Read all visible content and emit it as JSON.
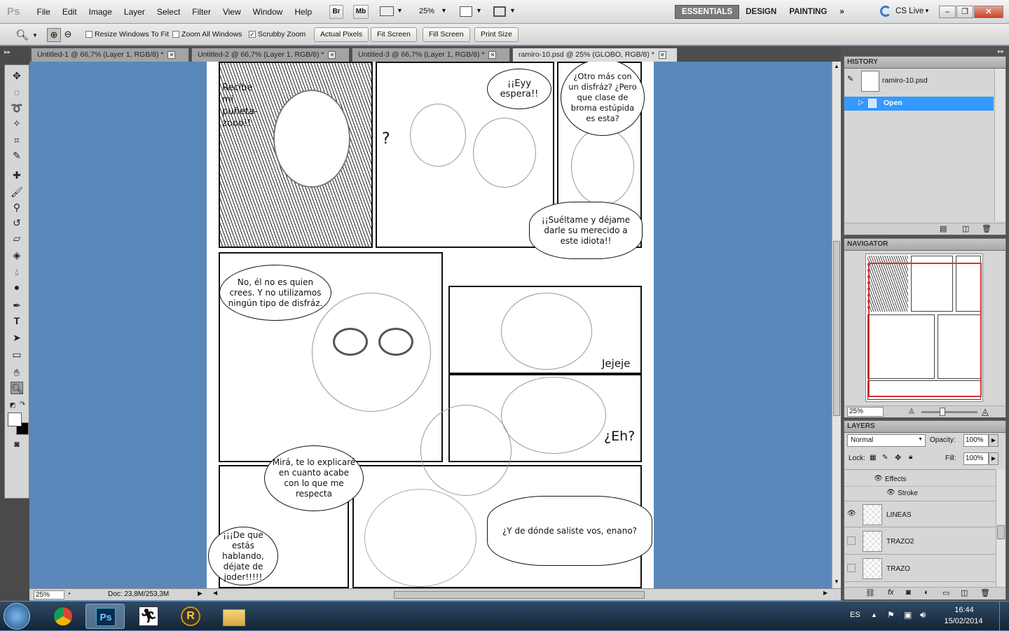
{
  "app": {
    "logo": "Ps"
  },
  "menu": [
    "File",
    "Edit",
    "Image",
    "Layer",
    "Select",
    "Filter",
    "View",
    "Window",
    "Help"
  ],
  "appbar": {
    "br": "Br",
    "mb": "Mb",
    "zoom": "25%"
  },
  "workspaces": [
    "ESSENTIALS",
    "DESIGN",
    "PAINTING"
  ],
  "cslive": "CS Live",
  "options": {
    "resize_windows": "Resize Windows To Fit",
    "zoom_all": "Zoom All Windows",
    "scrubby": "Scrubby Zoom",
    "scrubby_checked": true,
    "actual_pixels": "Actual Pixels",
    "fit_screen": "Fit Screen",
    "fill_screen": "Fill Screen",
    "print_size": "Print Size"
  },
  "tabs": [
    {
      "label": "Untitled-1 @ 66,7% (Layer 1, RGB/8) *"
    },
    {
      "label": "Untitled-2 @ 66,7% (Layer 1, RGB/8) *"
    },
    {
      "label": "Untitled-3 @ 66,7% (Layer 1, RGB/8) *"
    },
    {
      "label": "ramiro-10.psd @ 25% (GLOBO, RGB/8) *"
    }
  ],
  "comic": {
    "b1": "Recibe mi puñeta-zooo!!",
    "q": "?",
    "b2": "¡¡Eyy espera!!",
    "b3": "¿Otro más con un disfráz? ¿Pero que clase de broma estúpida es esta?",
    "b4": "¡¡Suéltame y déjame darle su merecido a este idiota!!",
    "b5": "No, él no es quien crees. Y no utilizamos ningún tipo de disfráz.",
    "b6": "Jejeje",
    "b7": "¿Eh?",
    "b8": "Mirá, te lo explicaré en cuanto acabe con lo que me respecta",
    "b9": "¡¡¡De que estás hablando, déjate de joder!!!!!",
    "b10": "¿Y de dónde saliste vos, enano?"
  },
  "status": {
    "zoom": "25%",
    "doc": "Doc: 23,8M/253,3M"
  },
  "history": {
    "title": "HISTORY",
    "file": "ramiro-10.psd",
    "step": "Open"
  },
  "navigator": {
    "title": "NAVIGATOR",
    "zoom": "25%"
  },
  "layers": {
    "title": "LAYERS",
    "blend": "Normal",
    "opacity_label": "Opacity:",
    "opacity": "100%",
    "lock_label": "Lock:",
    "fill_label": "Fill:",
    "fill": "100%",
    "effects": "Effects",
    "stroke": "Stroke",
    "rows": [
      {
        "name": "LINEAS"
      },
      {
        "name": "TRAZO2"
      },
      {
        "name": "TRAZO"
      }
    ]
  },
  "taskbar": {
    "lang": "ES",
    "time": "16:44",
    "date": "15/02/2014"
  },
  "colors": {
    "accent": "#3399ff",
    "canvas_bg": "#5a88ba",
    "dock": "#535353"
  }
}
